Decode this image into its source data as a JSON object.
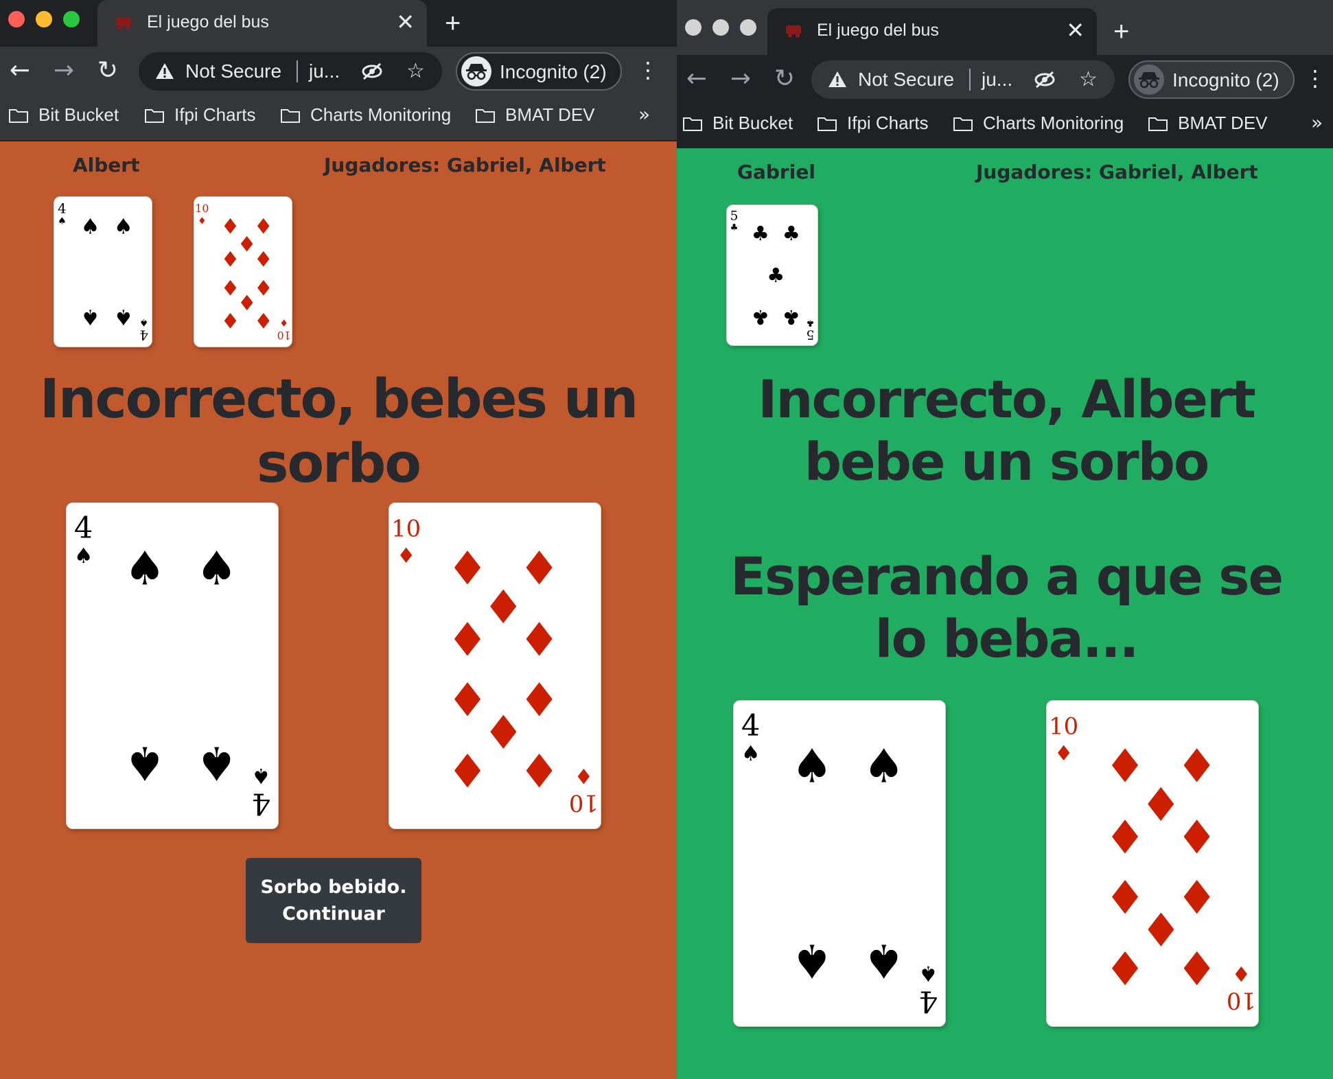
{
  "left_window": {
    "tab_title": "El juego del bus",
    "security_label": "Not Secure",
    "url": "ju...",
    "incognito_label": "Incognito (2)",
    "bookmarks": [
      "Bit Bucket",
      "Ifpi Charts",
      "Charts Monitoring",
      "BMAT DEV"
    ],
    "bookmarks_more": "»",
    "page": {
      "player_name": "Albert",
      "players_label": "Jugadores: Gabriel, Albert",
      "hand": [
        {
          "rank": "4",
          "suit": "spades"
        },
        {
          "rank": "10",
          "suit": "diamonds"
        }
      ],
      "message": "Incorrecto, bebes un sorbo",
      "table_cards": [
        {
          "rank": "4",
          "suit": "spades"
        },
        {
          "rank": "10",
          "suit": "diamonds"
        }
      ],
      "button_label": "Sorbo bebido. Continuar",
      "background_color": "#c0592d"
    }
  },
  "right_window": {
    "tab_title": "El juego del bus",
    "security_label": "Not Secure",
    "url": "ju...",
    "incognito_label": "Incognito (2)",
    "bookmarks": [
      "Bit Bucket",
      "Ifpi Charts",
      "Charts Monitoring",
      "BMAT DEV"
    ],
    "bookmarks_more": "»",
    "page": {
      "player_name": "Gabriel",
      "players_label": "Jugadores: Gabriel, Albert",
      "hand": [
        {
          "rank": "5",
          "suit": "clubs"
        }
      ],
      "message": "Incorrecto, Albert bebe un sorbo",
      "waiting_message": "Esperando a que se lo beba...",
      "table_cards": [
        {
          "rank": "4",
          "suit": "spades"
        },
        {
          "rank": "10",
          "suit": "diamonds"
        }
      ],
      "background_color": "#21ad61"
    }
  },
  "colors": {
    "card_red": "#cc1f00",
    "card_black": "#000000",
    "heading_text": "#262a2e",
    "button_bg": "#343a40"
  }
}
